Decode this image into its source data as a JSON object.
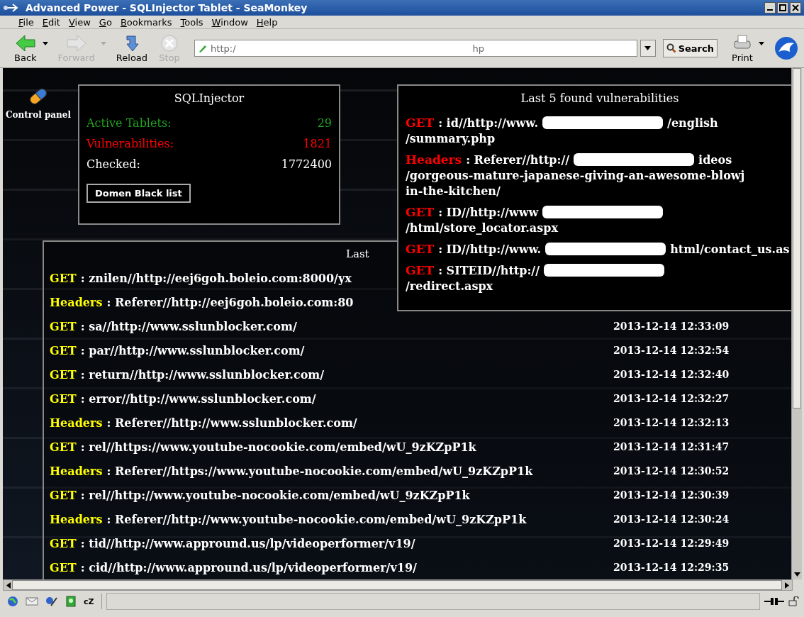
{
  "window": {
    "title": "Advanced Power - SQLInjector Tablet - SeaMonkey"
  },
  "menu": [
    "File",
    "Edit",
    "View",
    "Go",
    "Bookmarks",
    "Tools",
    "Window",
    "Help"
  ],
  "toolbar": {
    "buttons": [
      {
        "kind": "back",
        "label": "Back",
        "disabled": false,
        "dropdown": true
      },
      {
        "kind": "forward",
        "label": "Forward",
        "disabled": true,
        "dropdown": true
      },
      {
        "kind": "reload",
        "label": "Reload",
        "disabled": false,
        "dropdown": false
      },
      {
        "kind": "stop",
        "label": "Stop",
        "disabled": true,
        "dropdown": false
      }
    ],
    "url": {
      "before": "http:/",
      "after": "hp"
    },
    "search_button": "Search",
    "print_button": "Print"
  },
  "control_panel": {
    "label": "Control panel"
  },
  "stats": {
    "title": "SQLInjector",
    "rows": [
      {
        "kind": "good",
        "label": "Active Tablets:",
        "value": "29"
      },
      {
        "kind": "bad",
        "label": "Vulnerabilities:",
        "value": "1821"
      },
      {
        "kind": "plain",
        "label": "Checked:",
        "value": "1772400"
      }
    ],
    "button": "Domen Black list"
  },
  "last_found": {
    "title": "Last 5 found vulnerabilities",
    "entries": [
      {
        "method": "GET",
        "lines": [
          [
            {
              "kind": "text",
              "text": ": id//http://www."
            },
            {
              "kind": "redaction"
            },
            {
              "kind": "text",
              "text": "/english"
            }
          ],
          [
            {
              "kind": "text",
              "text": "/summary.php"
            }
          ]
        ]
      },
      {
        "method": "Headers",
        "lines": [
          [
            {
              "kind": "text",
              "text": ": Referer//http://"
            },
            {
              "kind": "redaction"
            },
            {
              "kind": "text",
              "text": "ideos"
            }
          ],
          [
            {
              "kind": "text",
              "text": "/gorgeous-mature-japanese-giving-an-awesome-blowj"
            }
          ],
          [
            {
              "kind": "text",
              "text": "in-the-kitchen/"
            }
          ]
        ]
      },
      {
        "method": "GET",
        "lines": [
          [
            {
              "kind": "text",
              "text": ": ID//http://www"
            },
            {
              "kind": "redaction"
            }
          ],
          [
            {
              "kind": "text",
              "text": "/html/store_locator.aspx"
            }
          ]
        ]
      },
      {
        "method": "GET",
        "lines": [
          [
            {
              "kind": "text",
              "text": ": ID//http://www."
            },
            {
              "kind": "redaction"
            },
            {
              "kind": "text",
              "text": "html/contact_us.as"
            }
          ]
        ]
      },
      {
        "method": "GET",
        "lines": [
          [
            {
              "kind": "text",
              "text": ": SITEID//http://"
            },
            {
              "kind": "redaction"
            }
          ],
          [
            {
              "kind": "text",
              "text": "/redirect.aspx"
            }
          ]
        ]
      }
    ]
  },
  "reports": {
    "title": "Last",
    "rows": [
      {
        "method": "GET",
        "text": ": znilen//http://eej6goh.boleio.com:8000/yx"
      },
      {
        "method": "Headers",
        "text": ": Referer//http://eej6goh.boleio.com:80"
      },
      {
        "method": "GET",
        "text": ": sa//http://www.sslunblocker.com/",
        "time": "2013-12-14 12:33:09"
      },
      {
        "method": "GET",
        "text": ": par//http://www.sslunblocker.com/",
        "time": "2013-12-14 12:32:54"
      },
      {
        "method": "GET",
        "text": ": return//http://www.sslunblocker.com/",
        "time": "2013-12-14 12:32:40"
      },
      {
        "method": "GET",
        "text": ": error//http://www.sslunblocker.com/",
        "time": "2013-12-14 12:32:27"
      },
      {
        "method": "Headers",
        "text": ": Referer//http://www.sslunblocker.com/",
        "time": "2013-12-14 12:32:13"
      },
      {
        "method": "GET",
        "text": ": rel//https://www.youtube-nocookie.com/embed/wU_9zKZpP1k",
        "time": "2013-12-14 12:31:47"
      },
      {
        "method": "Headers",
        "text": ": Referer//https://www.youtube-nocookie.com/embed/wU_9zKZpP1k",
        "time": "2013-12-14 12:30:52"
      },
      {
        "method": "GET",
        "text": ": rel//http://www.youtube-nocookie.com/embed/wU_9zKZpP1k",
        "time": "2013-12-14 12:30:39"
      },
      {
        "method": "Headers",
        "text": ": Referer//http://www.youtube-nocookie.com/embed/wU_9zKZpP1k",
        "time": "2013-12-14 12:30:24"
      },
      {
        "method": "GET",
        "text": ": tid//http://www.appround.us/lp/videoperformer/v19/",
        "time": "2013-12-14 12:29:49"
      },
      {
        "method": "GET",
        "text": ": cid//http://www.appround.us/lp/videoperformer/v19/",
        "time": "2013-12-14 12:29:35"
      }
    ]
  },
  "status_bar": {
    "chat_label": "cZ"
  }
}
